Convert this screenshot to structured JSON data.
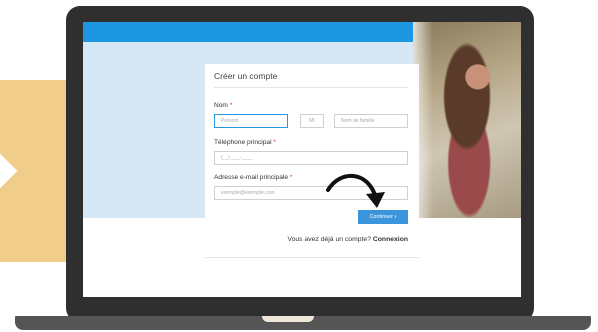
{
  "form": {
    "title": "Créer un compte",
    "name_label": "Nom",
    "required_mark": "*",
    "first_name_placeholder": "Prénom",
    "middle_initial_placeholder": "MI",
    "last_name_placeholder": "Nom de famille",
    "phone_label": "Téléphone principal",
    "phone_placeholder": "(__) ___-____",
    "email_label": "Adresse e-mail principale",
    "email_placeholder": "exemple@exemple.com",
    "continue_label": "Continuer",
    "continue_icon": "chevron-right-icon",
    "login_prompt": "Vous avez déjà un compte?",
    "login_link": "Connexion"
  },
  "colors": {
    "header_blue": "#1e97e2",
    "light_blue": "#d6e8f6",
    "button_blue": "#3b95dc",
    "required_red": "#e0243c",
    "tan": "#f0cd8a",
    "laptop_frame": "#2f2f2f"
  },
  "decorations": {
    "arrow": "curved-arrow-icon",
    "photo": "woman-photo"
  }
}
